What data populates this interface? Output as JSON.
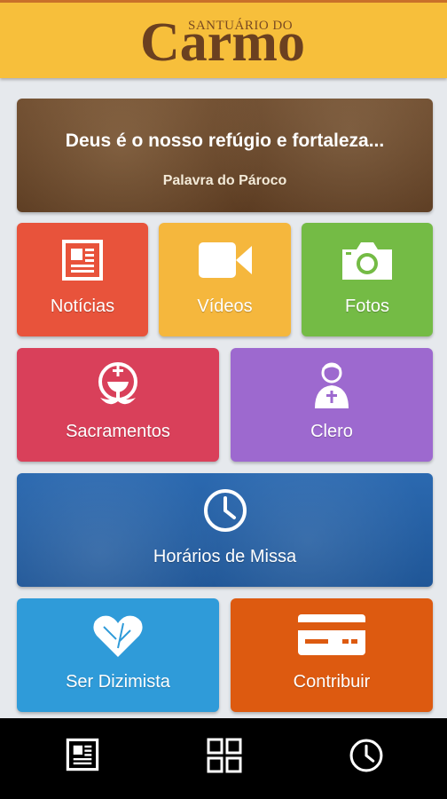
{
  "header": {
    "logo_small": "SANTUÁRIO DO",
    "logo_big": "Carmo"
  },
  "banner": {
    "title": "Deus é o nosso refúgio e fortaleza...",
    "subtitle": "Palavra do Pároco"
  },
  "tiles": {
    "noticias": "Notícias",
    "videos": "Vídeos",
    "fotos": "Fotos",
    "sacramentos": "Sacramentos",
    "clero": "Clero",
    "horarios": "Horários de Missa",
    "dizimista": "Ser Dizimista",
    "contribuir": "Contribuir"
  },
  "colors": {
    "header": "#f7bf3b",
    "noticias": "#e8533b",
    "videos": "#f5b73d",
    "fotos": "#74bb45",
    "sacramentos": "#d9405a",
    "clero": "#9d69cf",
    "horarios": "#2563a8",
    "dizimista": "#2f9bd9",
    "contribuir": "#dd5a10",
    "navbar": "#000000"
  },
  "icons": {
    "noticias": "newspaper-icon",
    "videos": "video-camera-icon",
    "fotos": "camera-icon",
    "sacramentos": "chalice-icon",
    "clero": "priest-icon",
    "horarios": "clock-icon",
    "dizimista": "heart-icon",
    "contribuir": "credit-card-icon",
    "nav": [
      "newspaper-icon",
      "grid-icon",
      "clock-icon"
    ]
  }
}
